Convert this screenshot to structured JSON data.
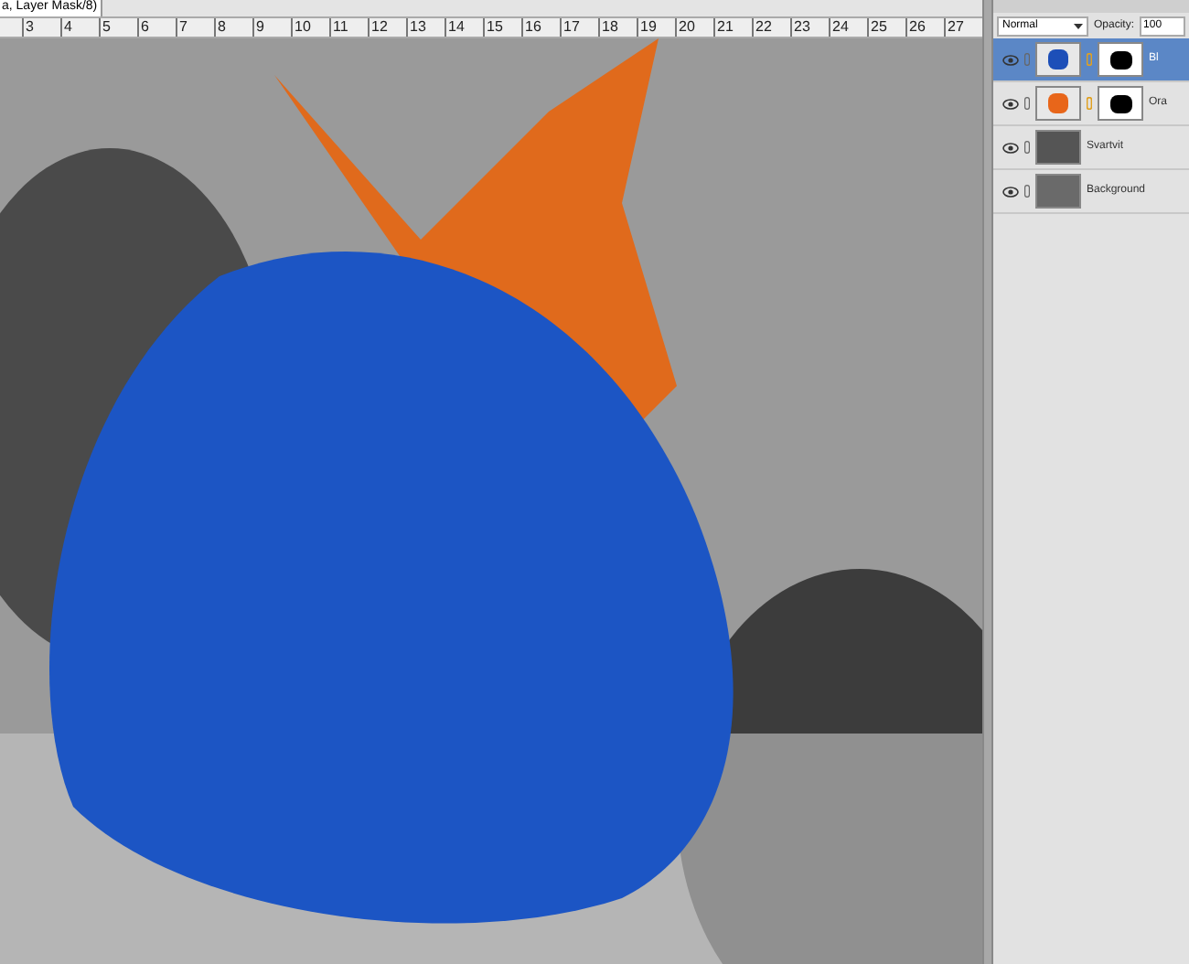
{
  "document_tab": {
    "title": "a, Layer Mask/8)"
  },
  "ruler": {
    "ticks": [
      "3",
      "4",
      "5",
      "6",
      "7",
      "8",
      "9",
      "10",
      "11",
      "12",
      "13",
      "14",
      "15",
      "16",
      "17",
      "18",
      "19",
      "20",
      "21",
      "22",
      "23",
      "24",
      "25",
      "26",
      "27"
    ]
  },
  "layers_panel": {
    "blend_mode": "Normal",
    "opacity_label": "Opacity:",
    "opacity_value": "100",
    "layers": [
      {
        "name": "Bl",
        "kind": "masked",
        "color": "#1d4fb8",
        "selected": true,
        "visible": true
      },
      {
        "name": "Ora",
        "kind": "masked",
        "color": "#e8661a",
        "selected": false,
        "visible": true
      },
      {
        "name": "Svartvit",
        "kind": "plain",
        "color": "#555555",
        "selected": false,
        "visible": true
      },
      {
        "name": "Background",
        "kind": "plain",
        "color": "#6a6a6a",
        "selected": false,
        "visible": true
      }
    ]
  }
}
